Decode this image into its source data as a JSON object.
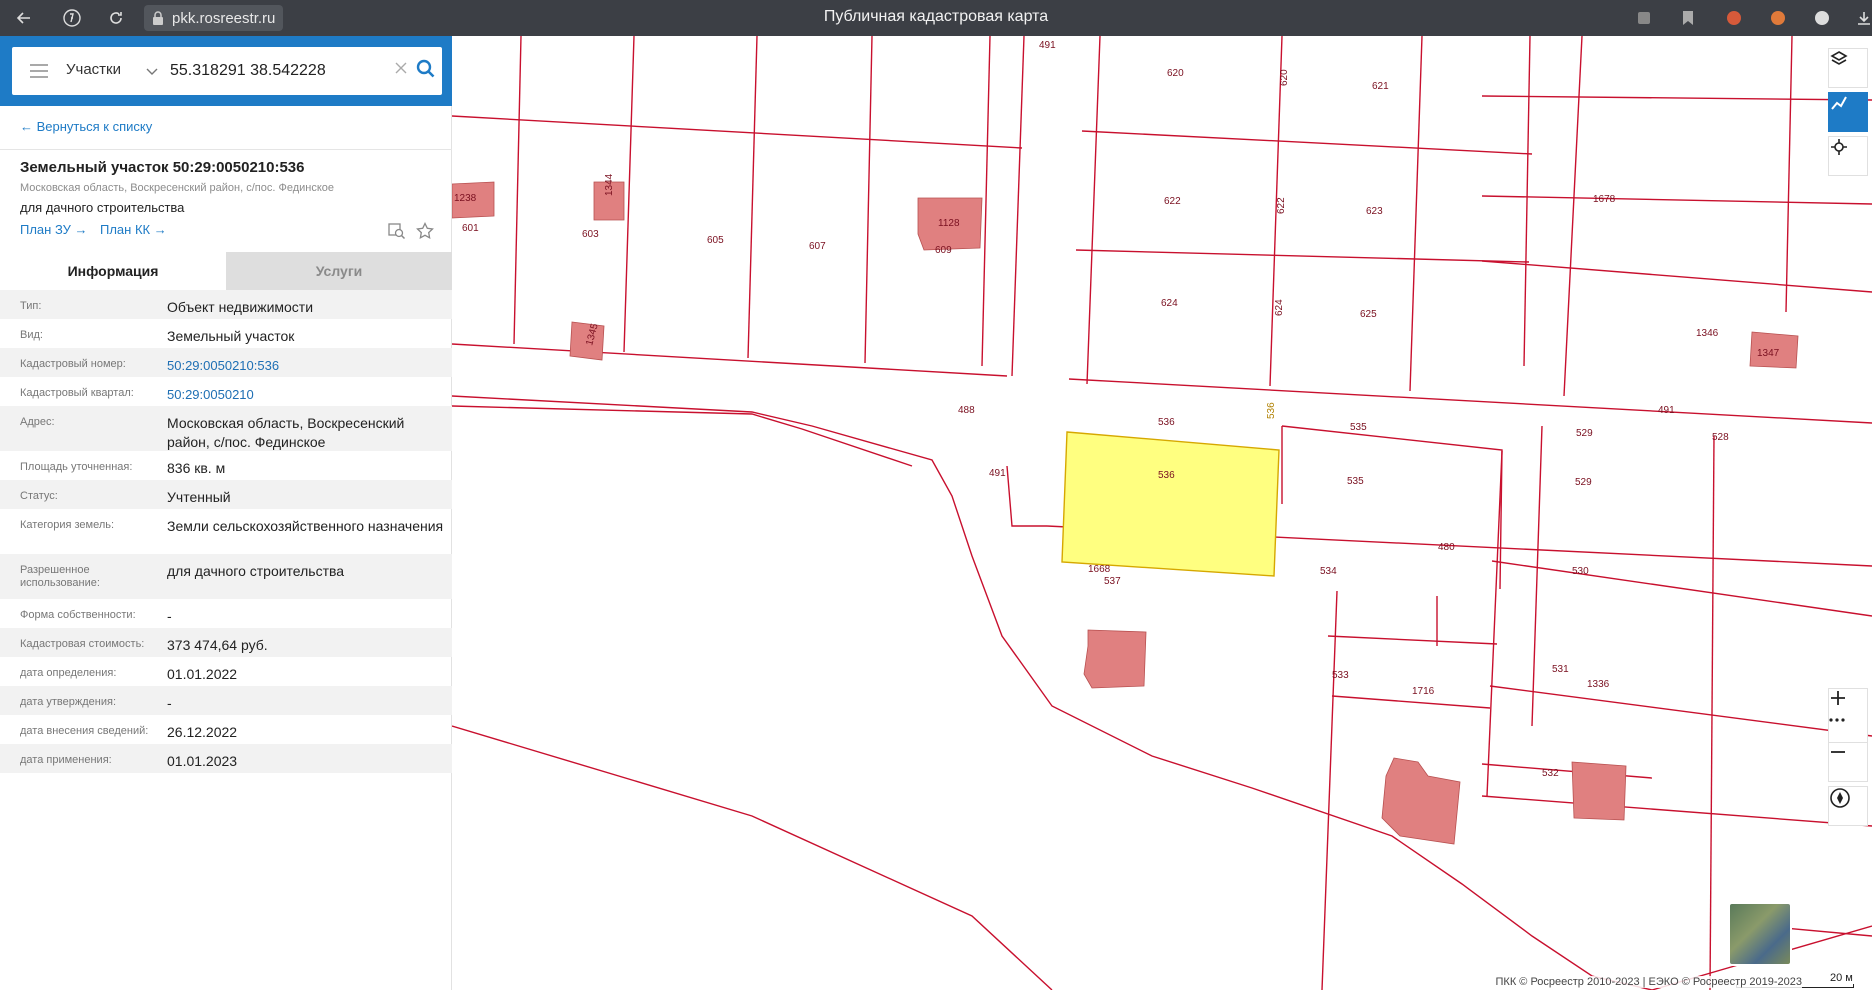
{
  "browser": {
    "url": "pkk.rosreestr.ru",
    "title": "Публичная кадастровая карта"
  },
  "search": {
    "type": "Участки",
    "query": "55.318291 38.542228"
  },
  "panel": {
    "back_link": "← Вернуться к списку",
    "title": "Земельный участок 50:29:0050210:536",
    "address": "Московская область, Воскресенский район, с/пос. Фединское",
    "use": "для дачного строительства",
    "plan_zu": "План ЗУ →",
    "plan_kk": "План КК →",
    "tab_info": "Информация",
    "tab_services": "Услуги"
  },
  "attributes": [
    {
      "key": "Тип:",
      "value": "Объект недвижимости"
    },
    {
      "key": "Вид:",
      "value": "Земельный участок"
    },
    {
      "key": "Кадастровый номер:",
      "value": "50:29:0050210:536",
      "link": true
    },
    {
      "key": "Кадастровый квартал:",
      "value": "50:29:0050210",
      "link": true
    },
    {
      "key": "Адрес:",
      "value": "Московская область, Воскресенский район, с/пос. Фединское"
    },
    {
      "key": "Площадь уточненная:",
      "value": "836 кв. м"
    },
    {
      "key": "Статус:",
      "value": "Учтенный"
    },
    {
      "key": "Категория земель:",
      "value": "Земли сельскохозяйственного назначения"
    },
    {
      "key": "Разрешенное использование:",
      "value": "для дачного строительства"
    },
    {
      "key": "Форма собственности:",
      "value": "-"
    },
    {
      "key": "Кадастровая стоимость:",
      "value": "373 474,64 руб."
    },
    {
      "key": "дата определения:",
      "value": "01.01.2022"
    },
    {
      "key": "дата утверждения:",
      "value": "-"
    },
    {
      "key": "дата внесения сведений:",
      "value": "26.12.2022"
    },
    {
      "key": "дата применения:",
      "value": "01.01.2023"
    }
  ],
  "map": {
    "scale": "20 м",
    "attribution": "ПКК © Росреестр 2010-2023 | ЕЭКО © Росреестр 2019-2023",
    "parcel_labels": [
      "491",
      "620",
      "620",
      "621",
      "1238",
      "1344",
      "1128",
      "601",
      "603",
      "605",
      "607",
      "609",
      "622",
      "622",
      "623",
      "1678",
      "1345",
      "624",
      "624",
      "625",
      "1347",
      "1346",
      "488",
      "536",
      "536",
      "535",
      "491",
      "529",
      "528",
      "491",
      "536",
      "535",
      "529",
      "480",
      "1668",
      "537",
      "534",
      "530",
      "533",
      "1716",
      "531",
      "1336",
      "532"
    ]
  },
  "colors": {
    "accent": "#1e7bc6",
    "parcel_line": "#c8102e",
    "selected_fill": "#ffff80",
    "building": "#e07b7b"
  }
}
